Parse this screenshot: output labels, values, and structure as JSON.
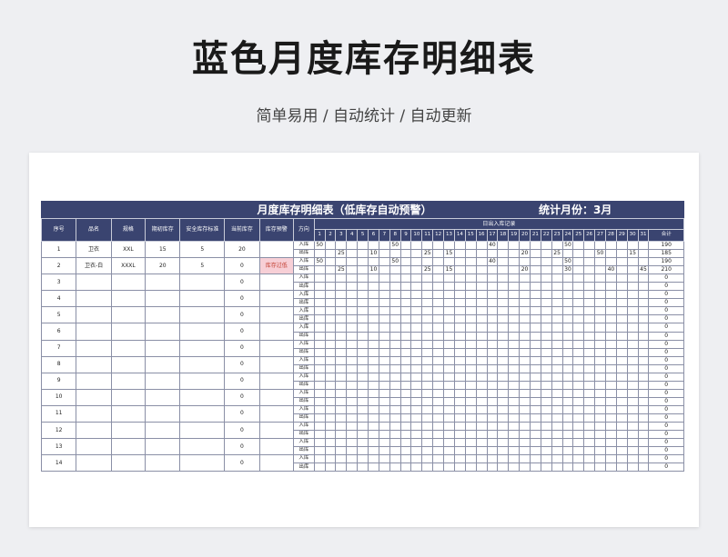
{
  "page": {
    "title": "蓝色月度库存明细表",
    "subtitle": "简单易用 / 自动统计 / 自动更新"
  },
  "sheet": {
    "banner_title": "月度库存明细表（低库存自动预警）",
    "banner_month": "统计月份：3月",
    "headers": {
      "seq": "序号",
      "name": "品名",
      "spec": "规格",
      "opening": "期初库存",
      "safety": "安全库存标准",
      "current": "当前库存",
      "alert": "库存预警",
      "direction": "方向",
      "daily": "日出入库记录",
      "total": "合计"
    },
    "days": [
      "1",
      "2",
      "3",
      "4",
      "5",
      "6",
      "7",
      "8",
      "9",
      "10",
      "11",
      "12",
      "13",
      "14",
      "15",
      "16",
      "17",
      "18",
      "19",
      "20",
      "21",
      "22",
      "23",
      "24",
      "25",
      "26",
      "27",
      "28",
      "29",
      "30",
      "31"
    ],
    "in_label": "入库",
    "out_label": "出库",
    "items": [
      {
        "seq": "1",
        "name": "卫衣",
        "spec": "XXL",
        "opening": "15",
        "safety": "5",
        "current": "20",
        "alert": "",
        "in": {
          "1": "50",
          "8": "50",
          "17": "40",
          "24": "50"
        },
        "in_total": "190",
        "out": {
          "3": "25",
          "6": "10",
          "11": "25",
          "13": "15",
          "20": "20",
          "23": "25",
          "27": "50",
          "30": "15"
        },
        "out_total": "185"
      },
      {
        "seq": "2",
        "name": "卫衣-白",
        "spec": "XXXL",
        "opening": "20",
        "safety": "5",
        "current": "0",
        "alert": "库存过低",
        "in": {
          "1": "50",
          "8": "50",
          "17": "40",
          "24": "50"
        },
        "in_total": "190",
        "out": {
          "3": "25",
          "6": "10",
          "11": "25",
          "13": "15",
          "20": "20",
          "24": "30",
          "28": "40",
          "31": "45"
        },
        "out_total": "210"
      },
      {
        "seq": "3",
        "current": "0",
        "in_total": "0",
        "out_total": "0"
      },
      {
        "seq": "4",
        "current": "0",
        "in_total": "0",
        "out_total": "0"
      },
      {
        "seq": "5",
        "current": "0",
        "in_total": "0",
        "out_total": "0"
      },
      {
        "seq": "6",
        "current": "0",
        "in_total": "0",
        "out_total": "0"
      },
      {
        "seq": "7",
        "current": "0",
        "in_total": "0",
        "out_total": "0"
      },
      {
        "seq": "8",
        "current": "0",
        "in_total": "0",
        "out_total": "0"
      },
      {
        "seq": "9",
        "current": "0",
        "in_total": "0",
        "out_total": "0"
      },
      {
        "seq": "10",
        "current": "0",
        "in_total": "0",
        "out_total": "0"
      },
      {
        "seq": "11",
        "current": "0",
        "in_total": "0",
        "out_total": "0"
      },
      {
        "seq": "12",
        "current": "0",
        "in_total": "0",
        "out_total": "0"
      },
      {
        "seq": "13",
        "current": "0",
        "in_total": "0",
        "out_total": "0"
      },
      {
        "seq": "14",
        "current": "0",
        "in_total": "0",
        "out_total": "0"
      }
    ]
  }
}
